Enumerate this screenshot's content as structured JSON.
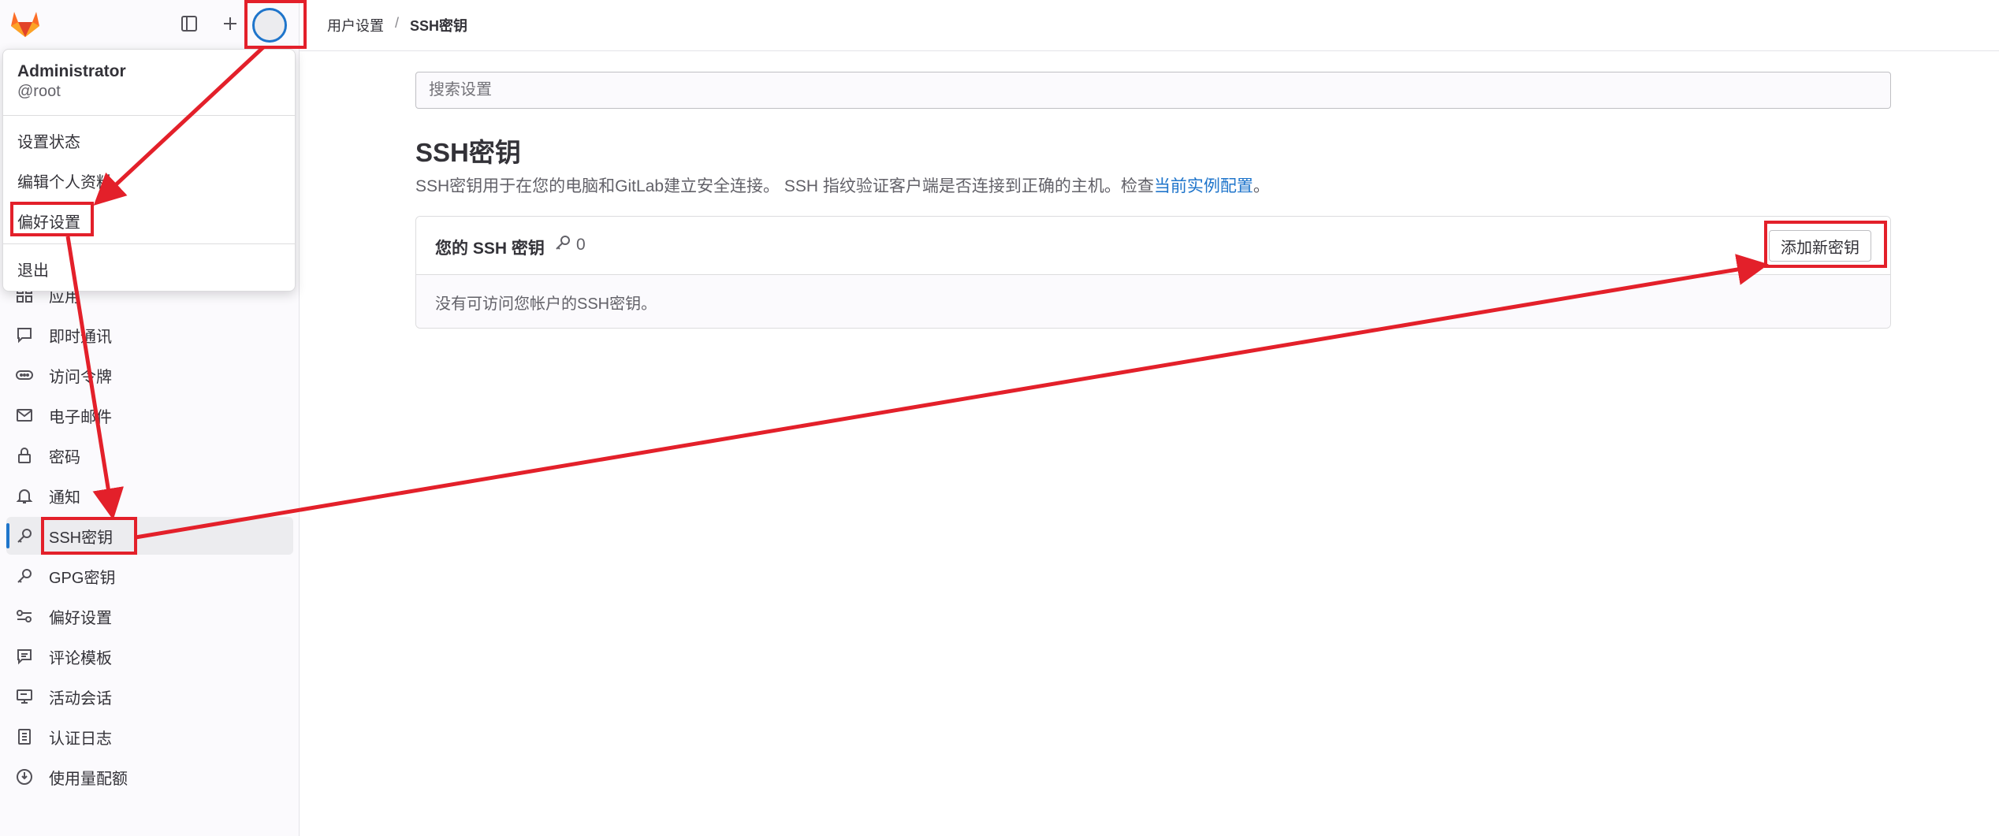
{
  "sidebar": {
    "items": [
      {
        "label": "应用",
        "icon": "applications-icon"
      },
      {
        "label": "即时通讯",
        "icon": "comment-icon"
      },
      {
        "label": "访问令牌",
        "icon": "token-icon"
      },
      {
        "label": "电子邮件",
        "icon": "mail-icon"
      },
      {
        "label": "密码",
        "icon": "lock-icon"
      },
      {
        "label": "通知",
        "icon": "bell-icon"
      },
      {
        "label": "SSH密钥",
        "icon": "key-icon",
        "active": true
      },
      {
        "label": "GPG密钥",
        "icon": "key-icon"
      },
      {
        "label": "偏好设置",
        "icon": "preferences-icon"
      },
      {
        "label": "评论模板",
        "icon": "comment-template-icon"
      },
      {
        "label": "活动会话",
        "icon": "monitor-icon"
      },
      {
        "label": "认证日志",
        "icon": "log-icon"
      },
      {
        "label": "使用量配额",
        "icon": "quota-icon"
      }
    ]
  },
  "user_menu": {
    "name": "Administrator",
    "handle": "@root",
    "items": [
      "设置状态",
      "编辑个人资料",
      "偏好设置",
      "退出"
    ]
  },
  "breadcrumb": {
    "parent": "用户设置",
    "separator": "/",
    "current": "SSH密钥"
  },
  "search": {
    "placeholder": "搜索设置"
  },
  "page": {
    "title": "SSH密钥",
    "description": "SSH密钥用于在您的电脑和GitLab建立安全连接。 SSH 指纹验证客户端是否连接到正确的主机。检查",
    "description_link": "当前实例配置",
    "description_end": "。"
  },
  "keys_card": {
    "title": "您的 SSH 密钥",
    "count": "0",
    "add_button": "添加新密钥",
    "empty_text": "没有可访问您帐户的SSH密钥。"
  },
  "colors": {
    "accent": "#1f75cb",
    "annotation": "#e3202a"
  }
}
